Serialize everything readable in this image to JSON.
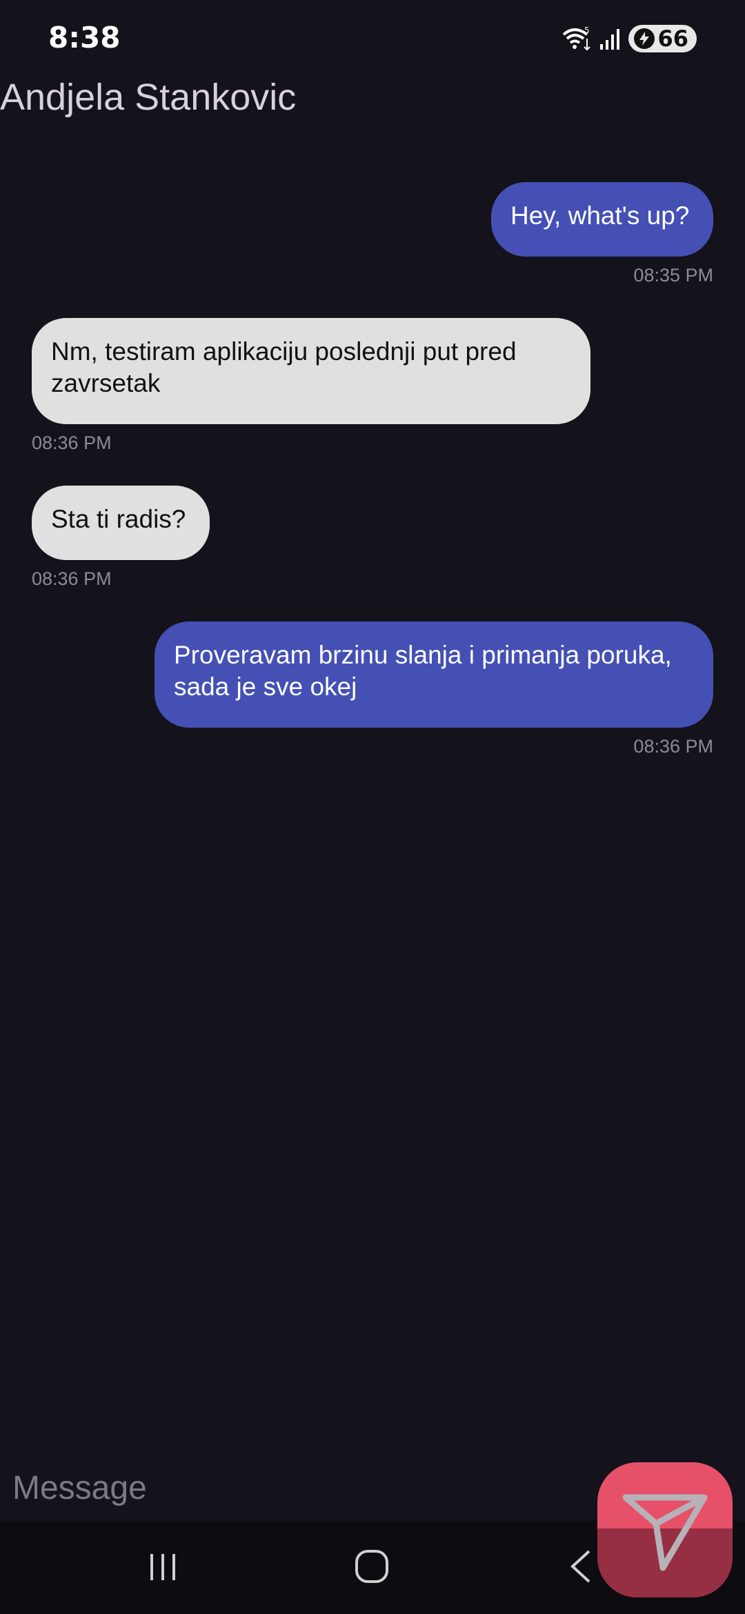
{
  "status_bar": {
    "time": "8:38",
    "battery_level": "66",
    "icons": [
      "wifi-icon",
      "signal-icon",
      "battery-charging-icon"
    ]
  },
  "header": {
    "contact_name": "Andjela Stankovic"
  },
  "messages": [
    {
      "direction": "outgoing",
      "text": "Hey, what's up?",
      "time": "08:35 PM"
    },
    {
      "direction": "incoming",
      "text": "Nm, testiram aplikaciju poslednji put pred zavrsetak",
      "time": "08:36 PM"
    },
    {
      "direction": "incoming",
      "text": "Sta ti radis?",
      "time": "08:36 PM"
    },
    {
      "direction": "outgoing",
      "text": "Proveravam brzinu slanja i primanja poruka, sada je sve okej",
      "time": "08:36 PM"
    }
  ],
  "composer": {
    "placeholder": "Message",
    "value": ""
  },
  "colors": {
    "background": "#14121a",
    "outgoing_bubble": "#4550b4",
    "incoming_bubble": "#e0e0e0",
    "send_button": "#e65169"
  },
  "nav": {
    "items": [
      "recent-apps-icon",
      "home-icon",
      "back-icon"
    ]
  }
}
